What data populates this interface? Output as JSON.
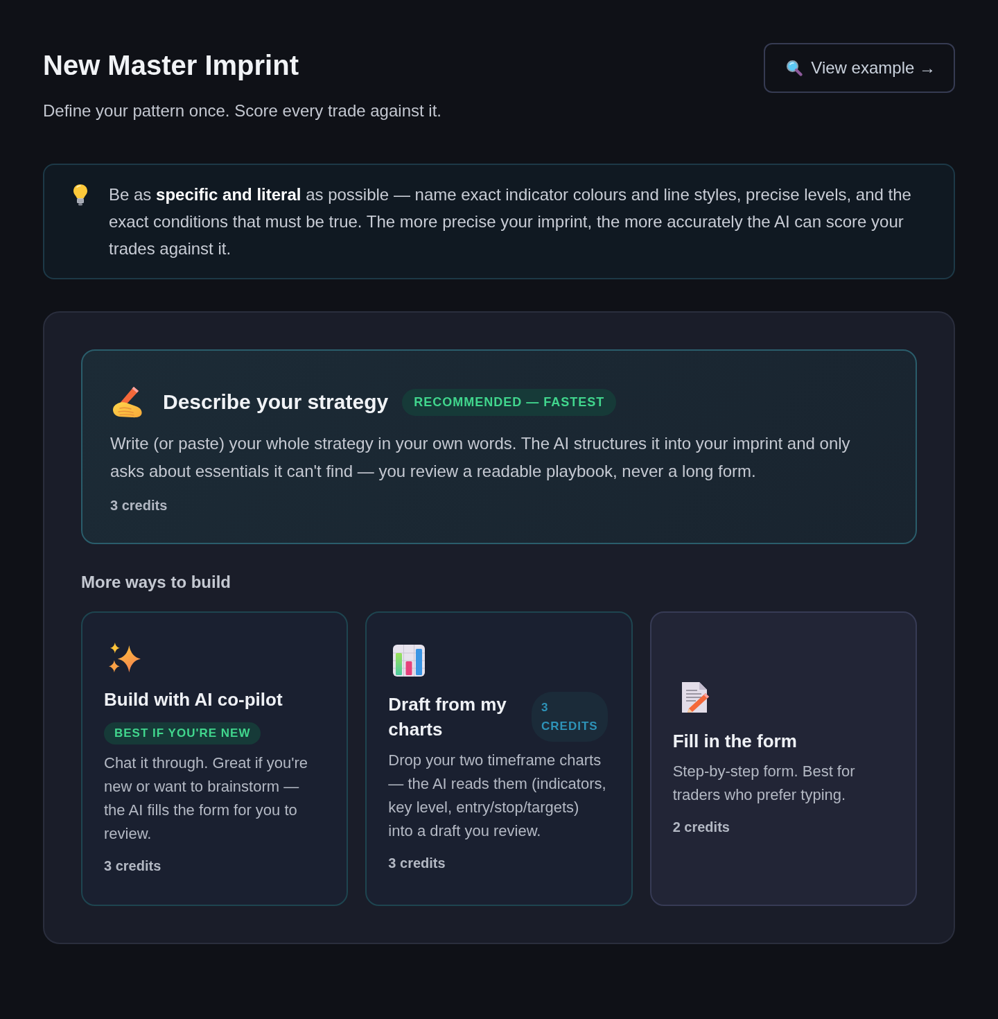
{
  "header": {
    "title": "New Master Imprint",
    "subtitle": "Define your pattern once. Score every trade against it.",
    "example_button": "View example →"
  },
  "tip": {
    "text": "Be as **specific and literal** as possible — name exact indicator colours and line styles, precise levels, and the exact conditions that must be true. The more precise your imprint, the more accurately the AI can score your trades against it."
  },
  "featured": {
    "title": "Describe your strategy",
    "badge": "RECOMMENDED — FASTEST",
    "description": "Write (or paste) your whole strategy in your own words. The AI structures it into your imprint and only asks about essentials it can't find — you review a readable playbook, never a long form.",
    "cost": "3 credits"
  },
  "more_heading": "More ways to build",
  "options": [
    {
      "kind": "chat",
      "title": "Build with AI co-pilot",
      "badge": {
        "kind": "tag",
        "text": "BEST IF YOU'RE NEW"
      },
      "description": "Chat it through. Great if you're new or want to brainstorm — the AI fills the form for you to review.",
      "cost": "3 credits"
    },
    {
      "kind": "charts",
      "title": "Draft from my charts",
      "badge": {
        "kind": "cost",
        "text": "3 CREDITS"
      },
      "description": "Drop your two timeframe charts — the AI reads them (indicators, key level, entry/stop/targets) into a draft you review.",
      "cost": "3 credits"
    },
    {
      "kind": "form",
      "title": "Fill in the form",
      "description": "Step-by-step form. Best for traders who prefer typing.",
      "cost": "2 credits"
    }
  ]
}
